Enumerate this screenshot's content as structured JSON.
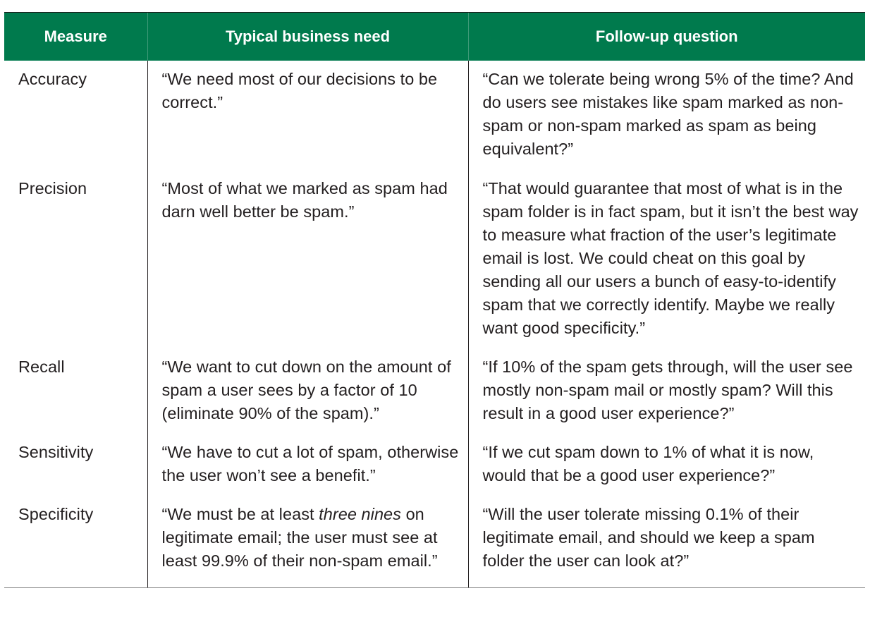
{
  "table": {
    "headers": [
      "Measure",
      "Typical business need",
      "Follow-up question"
    ],
    "rows": [
      {
        "measure": "Accuracy",
        "need": "“We need most of our decisions to be correct.”",
        "question": "“Can we tolerate being wrong 5% of the time? And do users see mistakes like spam marked as non-spam or non-spam marked as spam as being equivalent?”"
      },
      {
        "measure": "Precision",
        "need": "“Most of what we marked as spam had darn well better be spam.”",
        "question": "“That would guarantee that most of what is in the spam folder is in fact spam, but it isn’t the best way to measure what fraction of the user’s legitimate email is lost. We could cheat on this goal by sending all our users a bunch of easy-to-identify spam that we correctly identify. Maybe we really want good specificity.”"
      },
      {
        "measure": "Recall",
        "need": "“We want to cut down on the amount of spam a user sees by a factor of 10 (eliminate 90% of the spam).”",
        "question": "“If 10% of the spam gets through, will the user see mostly non-spam mail or mostly spam? Will this result in a good user experience?”"
      },
      {
        "measure": "Sensitivity",
        "need": "“We have to cut a lot of spam, otherwise the user won’t see a benefit.”",
        "question": "“If we cut spam down to 1% of what it is now, would that be a good user experience?”"
      },
      {
        "measure": "Specificity",
        "need_before": "“We must be at least ",
        "need_italic": "three nines",
        "need_after": " on legitimate email; the user must see at least 99.9% of their non-spam email.”",
        "question": "“Will the user tolerate missing 0.1% of their legitimate email, and should we keep a spam folder the user can look at?”"
      }
    ]
  }
}
